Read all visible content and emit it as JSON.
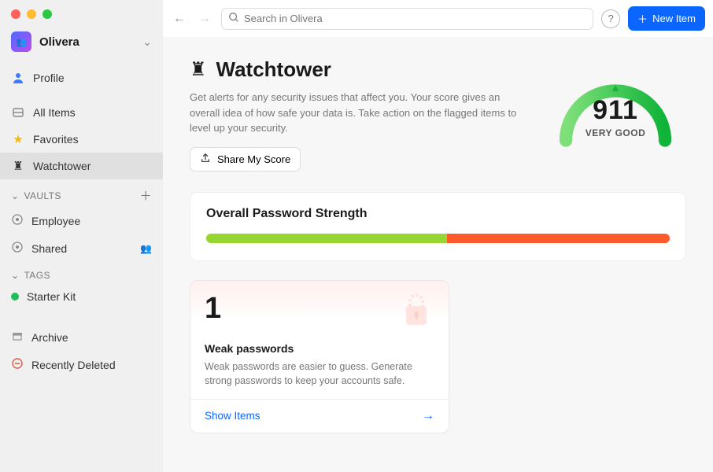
{
  "account": {
    "name": "Olivera"
  },
  "nav": {
    "profile": "Profile",
    "all_items": "All Items",
    "favorites": "Favorites",
    "watchtower": "Watchtower"
  },
  "sections": {
    "vaults_label": "VAULTS",
    "tags_label": "TAGS"
  },
  "vaults": [
    {
      "name": "Employee"
    },
    {
      "name": "Shared"
    }
  ],
  "tags": [
    {
      "name": "Starter Kit",
      "color": "#1fbf5f"
    }
  ],
  "footer_nav": {
    "archive": "Archive",
    "recently_deleted": "Recently Deleted"
  },
  "topbar": {
    "search_placeholder": "Search in Olivera",
    "new_item": "New Item"
  },
  "watchtower": {
    "title": "Watchtower",
    "subtitle": "Get alerts for any security issues that affect you. Your score gives an overall idea of how safe your data is. Take action on the flagged items to level up your security.",
    "share_button": "Share My Score",
    "score": "911",
    "score_label": "VERY GOOD",
    "gauge_color_start": "#7fe07a",
    "gauge_color_end": "#0fb338",
    "gauge_pct": 0.82
  },
  "strength": {
    "title": "Overall Password Strength",
    "good_pct": 52,
    "bad_pct": 48
  },
  "issues": [
    {
      "count": "1",
      "title": "Weak passwords",
      "desc": "Weak passwords are easier to guess. Generate strong passwords to keep your accounts safe.",
      "action": "Show Items"
    }
  ]
}
